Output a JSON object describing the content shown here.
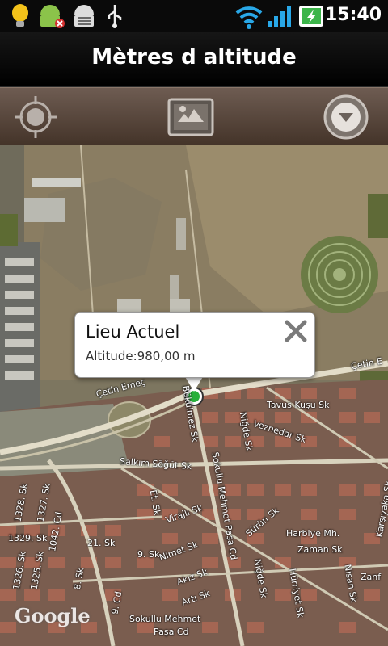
{
  "status_bar": {
    "time": "15:40",
    "icons": [
      "lightbulb-icon",
      "android-notification-icon",
      "android-debug-icon",
      "usb-icon",
      "wifi-icon",
      "signal-icon",
      "battery-charging-icon"
    ]
  },
  "title_bar": {
    "title": "Mètres d altitude"
  },
  "toolbar": {
    "buttons": [
      "my-location-icon",
      "map-view-icon",
      "dropdown-menu-icon"
    ]
  },
  "map": {
    "attribution": "Google",
    "callout": {
      "title": "Lieu Actuel",
      "subtitle": "Altitude:980,00 m"
    },
    "labels": {
      "cetin_emec_1": "Çetin Emeç",
      "cetin_emec_2": "Çetin Emeç",
      "cetin_e": "Çetin E",
      "tavus_kusu": "Tavus Kuşu Sk",
      "veznedar": "Veznedar Sk",
      "salkim_sogut": "Salkım Söğüt Sk",
      "sokullu_pasa": "Sokullu Mehmet Paşa Cd",
      "sokullu_mehmet": "Sokullu Mehmet",
      "pasa": "Paşa Cd",
      "harbiye": "Harbiye Mh.",
      "zaman": "Zaman Sk",
      "nisan": "Nisan Sk",
      "surun": "Sürün Sk",
      "nigde_1": "Niğde Sk",
      "nigde_2": "Niğde Sk",
      "huriyet": "Hürriyet Sk",
      "virajli": "Virajlı Sk",
      "nimet": "Nimet Sk",
      "akiz": "Akız Sk",
      "arti": "Artı Sk",
      "cd_1328": "1328. Sk",
      "cd_1327": "1327. Sk",
      "cd_1329": "1329. Sk",
      "cd_1326": "1326. Sk",
      "cd_1325": "1325. Sk",
      "cd_1042": "1042. Cd",
      "sk_21": "21. Sk",
      "sk_9": "9. Sk",
      "sk_8": "8. Sk",
      "zanf": "Zanf",
      "karsiyaka": "Karşıyaka Sk",
      "bukulmez": "Bükülmez Sk",
      "et_sk": "Et. Sk",
      "cd_9": "9. Cd"
    }
  }
}
